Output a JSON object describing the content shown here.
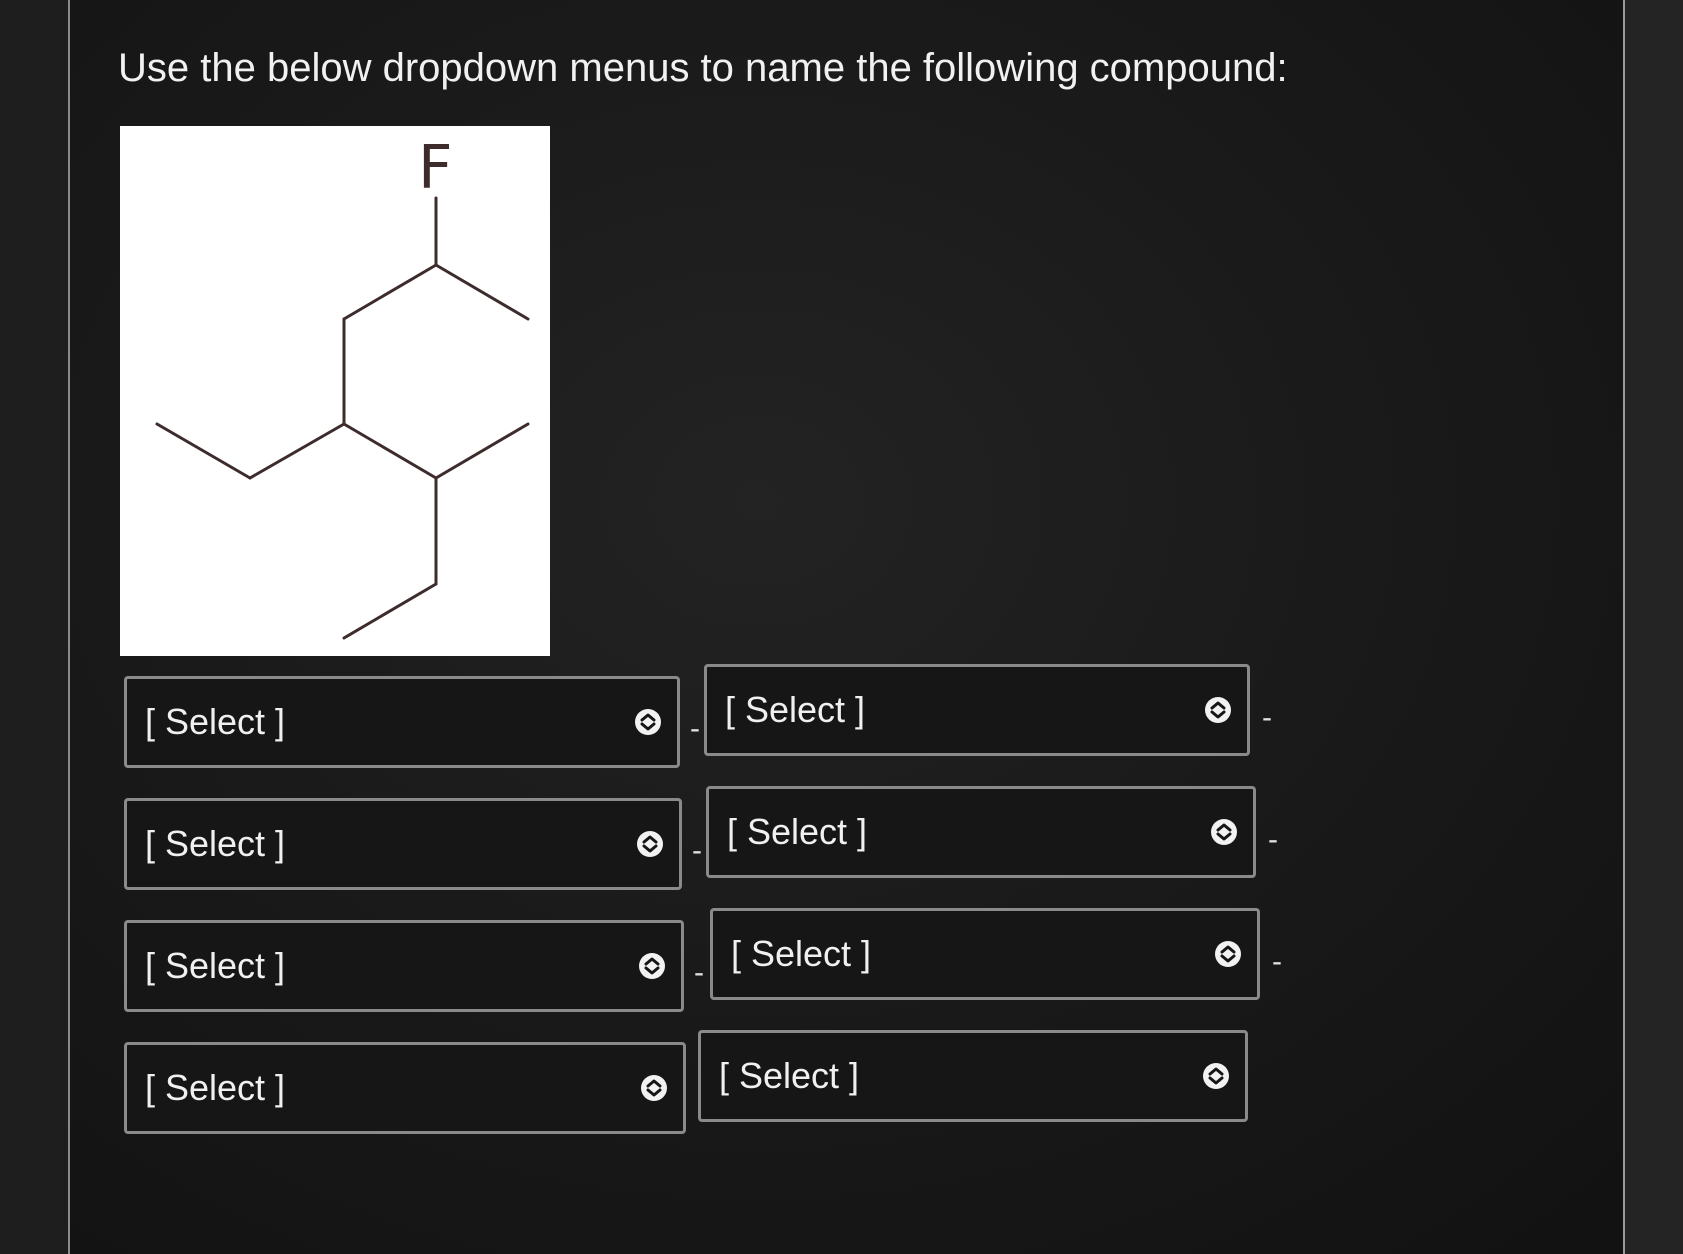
{
  "question": {
    "text": "Use the below dropdown menus to name the following compound:"
  },
  "molecule": {
    "atom_label": "F",
    "bond_color": "#3e2b2b"
  },
  "dropdowns": {
    "row1": {
      "left": "[ Select ]",
      "right": "[ Select ]",
      "sep_mid": "-",
      "sep_end": "-"
    },
    "row2": {
      "left": "[ Select ]",
      "right": "[ Select ]",
      "sep_mid": "-",
      "sep_end": "-"
    },
    "row3": {
      "left": "[ Select ]",
      "right": "[ Select ]",
      "sep_mid": "-",
      "sep_end": "-"
    },
    "row4": {
      "left": "[ Select ]",
      "right": "[ Select ]"
    }
  },
  "icons": {
    "dropdown_arrow": "up-down-chevron-icon"
  },
  "colors": {
    "background": "#151515",
    "text": "#f0f0f0",
    "dropdown_border": "#8a8a8a"
  }
}
